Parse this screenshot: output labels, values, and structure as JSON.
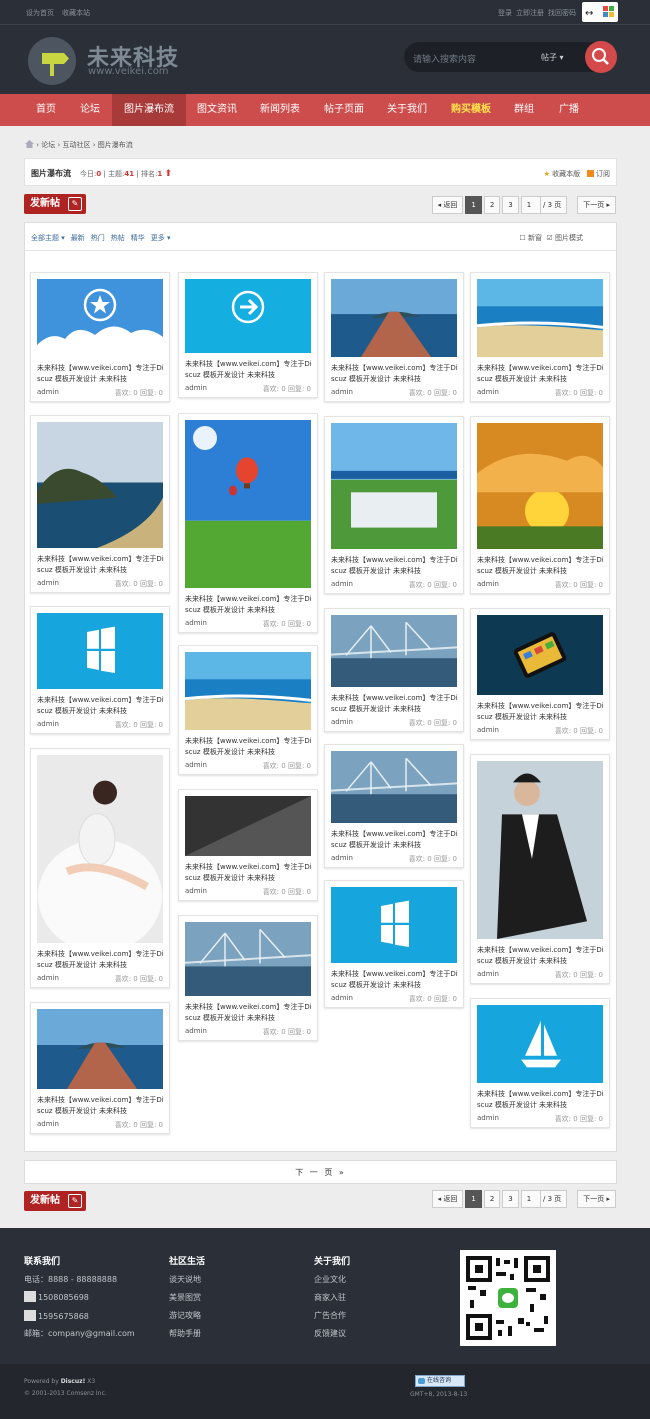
{
  "topbar": {
    "set_home": "设为首页",
    "bookmark": "收藏本站",
    "login": "登录",
    "register": "立即注册",
    "find_password": "找回密码"
  },
  "header": {
    "brand": "未来科技",
    "domain": "www.veikei.com",
    "search_placeholder": "请输入搜索内容",
    "search_scope": "帖子"
  },
  "nav": [
    "首页",
    "论坛",
    "图片瀑布流",
    "图文资讯",
    "新闻列表",
    "帖子页面",
    "关于我们",
    "购买模板",
    "群组",
    "广播"
  ],
  "breadcrumb": [
    "论坛",
    "互动社区",
    "图片瀑布流"
  ],
  "forum": {
    "title": "图片瀑布流",
    "today_label": "今日:",
    "today": "0",
    "topics_label": "主题:",
    "topics": "41",
    "rank_label": "排名:",
    "rank": "1",
    "favorite": "收藏本版",
    "subscribe": "订阅"
  },
  "newpost": "发新帖",
  "pager": {
    "back": "返回",
    "pages": [
      "1",
      "2",
      "3"
    ],
    "input": "1",
    "total": "/ 3 页",
    "next": "下一页"
  },
  "filter": {
    "all": "全部主题",
    "latest": "最新",
    "hot": "热门",
    "heat": "热帖",
    "digest": "精华",
    "more": "更多",
    "new_window": "新窗",
    "pic_mode": "图片模式"
  },
  "card_title": "未来科技【www.veikei.com】专注于Discuz 模板开发设计 未来科技",
  "card_author": "admin",
  "card_stats": "喜欢: 0  回复: 0",
  "next_page": "下 一 页 »",
  "footer": {
    "contact": {
      "title": "联系我们",
      "phone": "电话：8888 - 88888888",
      "qq1": "1508085698",
      "qq2": "1595675868",
      "email": "邮箱：company@gmail.com"
    },
    "community": {
      "title": "社区生活",
      "items": [
        "谈天说地",
        "美景图赏",
        "游记攻略",
        "帮助手册"
      ]
    },
    "about": {
      "title": "关于我们",
      "items": [
        "企业文化",
        "商家入驻",
        "广告合作",
        "反馈建议"
      ]
    }
  },
  "copyright": {
    "powered": "Powered by",
    "discuz": "Discuz!",
    "ver": "X3",
    "company": "© 2001-2013 Comsenz Inc.",
    "online": "在线咨询",
    "time": "GMT+8, 2013-8-13"
  }
}
